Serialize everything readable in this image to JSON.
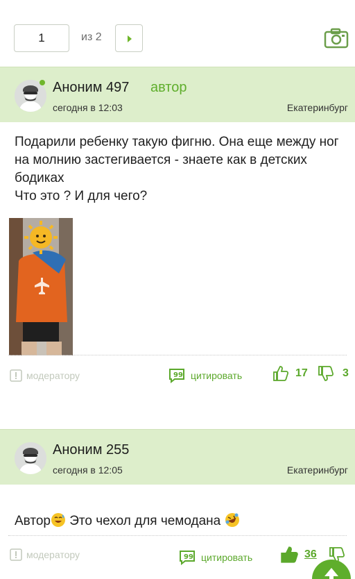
{
  "pagination": {
    "current_page": "1",
    "of_label": "из 2"
  },
  "posts": [
    {
      "author": "Аноним 497",
      "author_tag": "автор",
      "time": "сегодня в 12:03",
      "city": "Екатеринбург",
      "text": "Подарили ребенку такую фигню. Она еще между ног на молнию застегивается - знаете как в детских бодиках\nЧто это ? И для чего?",
      "moderator_label": "модератору",
      "quote_label": "цитировать",
      "likes": "17",
      "dislikes": "3"
    },
    {
      "author": "Аноним 255",
      "time": "сегодня в 12:05",
      "city": "Екатеринбург",
      "text_before": "Автор",
      "text_after": " Это чехол для чемодана ",
      "moderator_label": "модератору",
      "quote_label": "цитировать",
      "likes": "36"
    }
  ],
  "colors": {
    "accent": "#5fae2c",
    "header_bg": "#ddeecb",
    "muted": "#c2c9bc"
  },
  "icons": [
    "chevron-right-icon",
    "camera-icon",
    "avatar-icon",
    "flag-icon",
    "quote-icon",
    "thumbs-up-icon",
    "thumbs-down-icon",
    "smile-emoji",
    "laugh-emoji",
    "arrow-up-icon"
  ]
}
